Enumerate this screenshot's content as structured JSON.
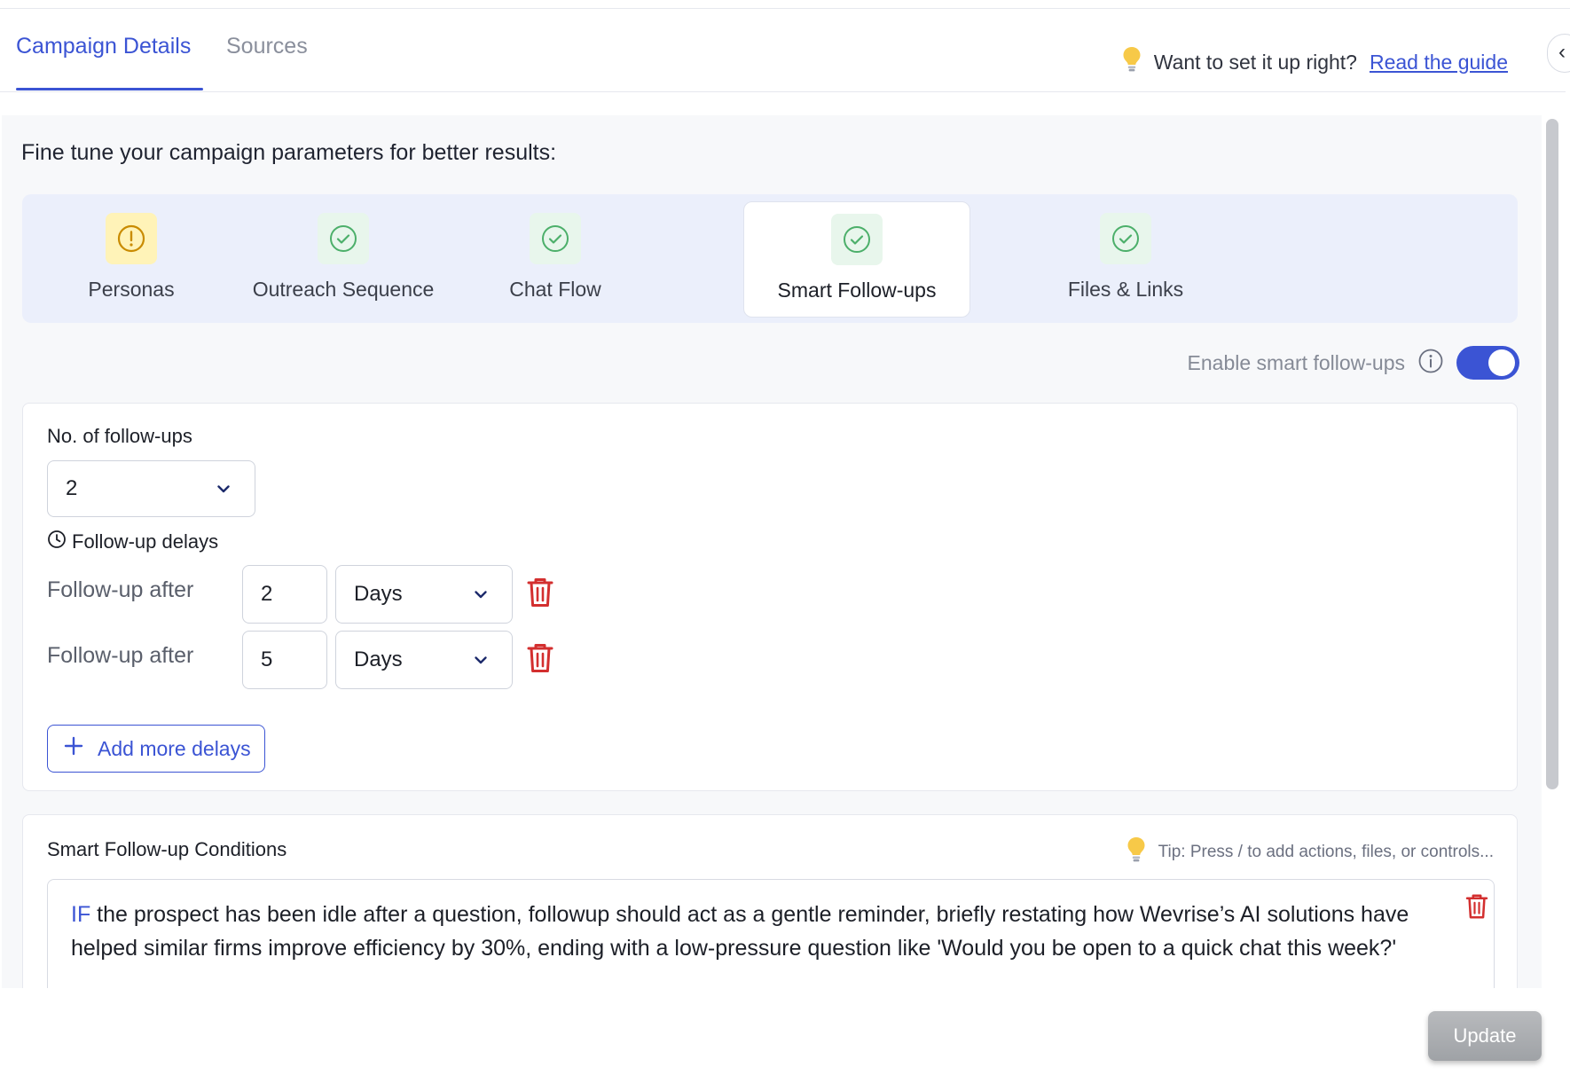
{
  "tabs": [
    {
      "label": "Campaign Details",
      "active": true
    },
    {
      "label": "Sources",
      "active": false
    }
  ],
  "guide": {
    "prompt": "Want to set it up right?",
    "link": "Read the guide"
  },
  "intro": "Fine tune your campaign parameters for better results:",
  "steps": [
    {
      "label": "Personas",
      "status": "warning"
    },
    {
      "label": "Outreach Sequence",
      "status": "complete"
    },
    {
      "label": "Chat Flow",
      "status": "complete"
    },
    {
      "label": "Smart Follow-ups",
      "status": "complete",
      "active": true
    },
    {
      "label": "Files & Links",
      "status": "complete"
    }
  ],
  "enable": {
    "label": "Enable smart follow-ups",
    "on": true
  },
  "followups": {
    "count_label": "No. of follow-ups",
    "count_value": "2",
    "delays_label": "Follow-up delays",
    "rows": [
      {
        "label": "Follow-up after",
        "value": "2",
        "unit": "Days"
      },
      {
        "label": "Follow-up after",
        "value": "5",
        "unit": "Days"
      }
    ],
    "add_label": "Add more delays"
  },
  "conditions": {
    "title": "Smart Follow-up Conditions",
    "tip": "Tip: Press / to add actions, files, or controls...",
    "keyword": "IF",
    "text": " the prospect has been idle after a question, followup should act as a gentle reminder, briefly restating how Wevrise’s AI solutions have helped similar firms improve efficiency by 30%, ending with a low-pressure question like 'Would you be open to a quick chat this week?'"
  },
  "update_label": "Update",
  "colors": {
    "accent": "#3b54d4",
    "danger": "#d32f2f",
    "success": "#4caf6a",
    "warning": "#e0a800"
  }
}
